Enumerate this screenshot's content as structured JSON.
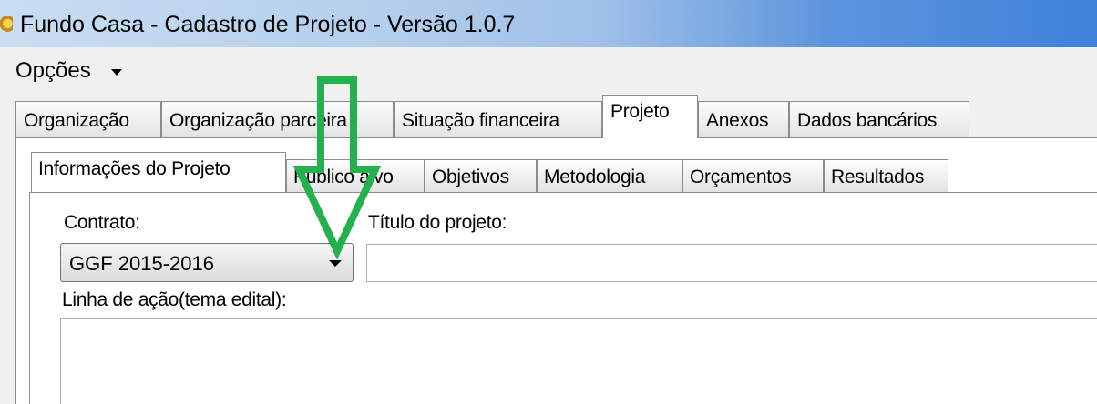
{
  "window": {
    "title": "Fundo Casa - Cadastro de Projeto - Versão 1.0.7",
    "icon": "app-icon",
    "titlebar_colors": [
      "#c9ddf2",
      "#3f80db"
    ]
  },
  "menu": {
    "items": [
      {
        "label": "Opções",
        "icon": "caret-down-icon"
      }
    ]
  },
  "outer_tabs": [
    {
      "label": "Organização",
      "active": false
    },
    {
      "label": "Organização parceira",
      "active": false
    },
    {
      "label": "Situação financeira",
      "active": false
    },
    {
      "label": "Projeto",
      "active": true
    },
    {
      "label": "Anexos",
      "active": false
    },
    {
      "label": "Dados bancários",
      "active": false
    }
  ],
  "inner_tabs": [
    {
      "label": "Informações do Projeto",
      "active": true
    },
    {
      "label": "Público alvo",
      "active": false
    },
    {
      "label": "Objetivos",
      "active": false
    },
    {
      "label": "Metodologia",
      "active": false
    },
    {
      "label": "Orçamentos",
      "active": false
    },
    {
      "label": "Resultados",
      "active": false
    }
  ],
  "form": {
    "contrato_label": "Contrato:",
    "contrato_value": "GGF 2015-2016",
    "titulo_label": "Título do projeto:",
    "titulo_value": "",
    "linha_label": "Linha de ação(tema edital):",
    "linha_value": ""
  },
  "annotation": {
    "icon": "down-arrow-annotation-icon",
    "color": "#22b14c"
  }
}
